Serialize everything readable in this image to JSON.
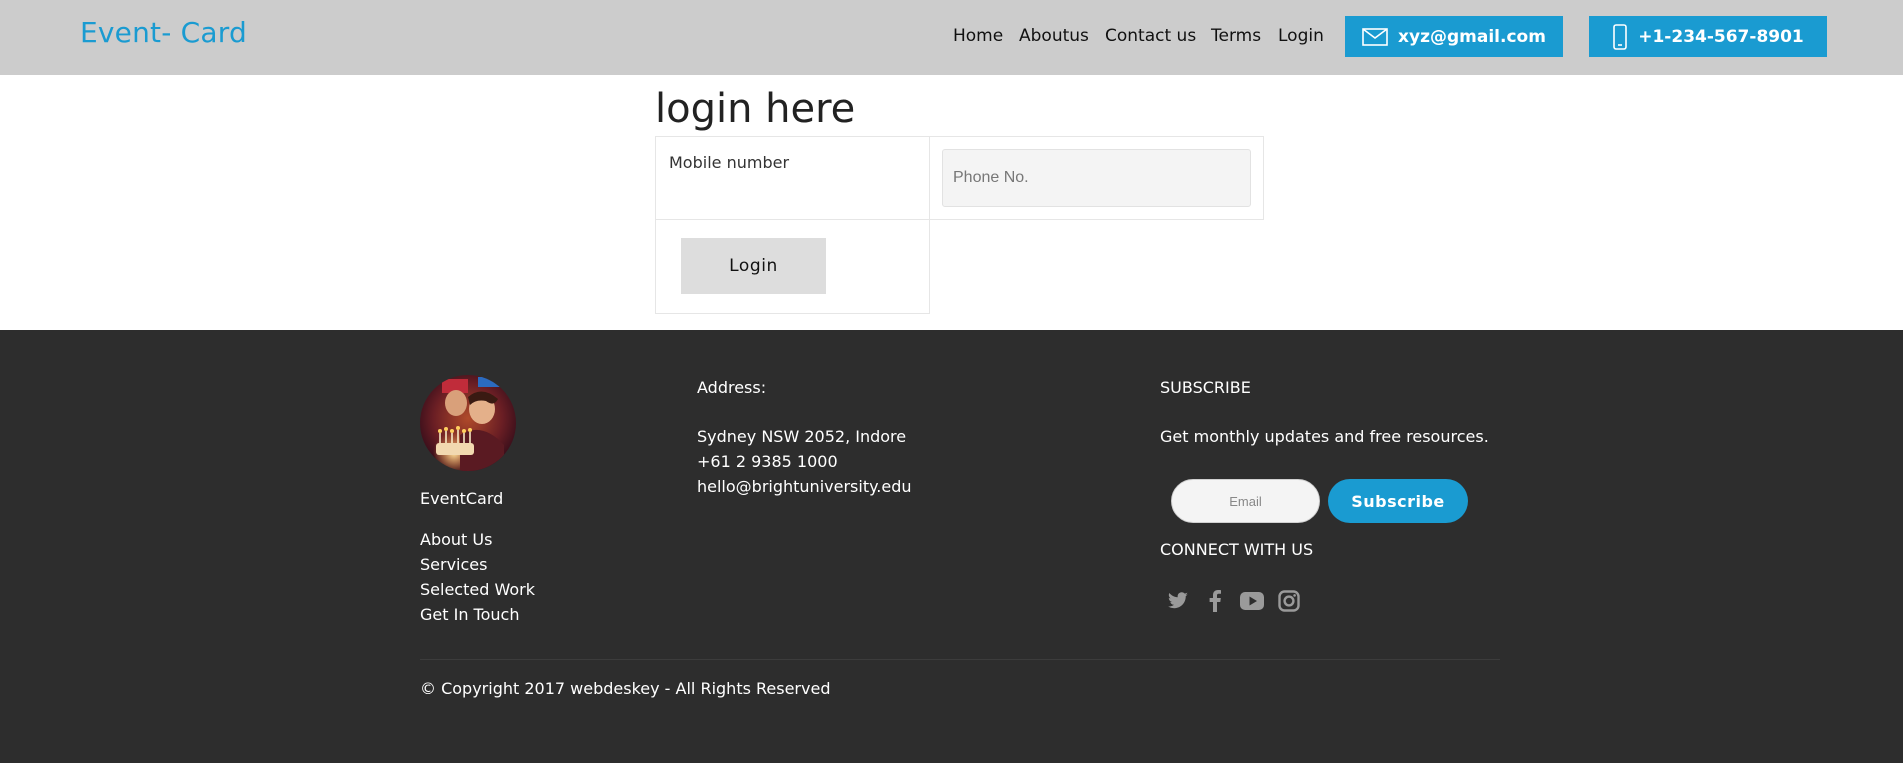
{
  "header": {
    "brand": "Event- Card",
    "nav": [
      "Home",
      "Aboutus",
      "Contact us",
      "Terms",
      "Login"
    ],
    "email": "xyz@gmail.com",
    "phone": "+1-234-567-8901",
    "icons": {
      "email": "envelope-icon",
      "phone": "mobile-phone-icon"
    },
    "accent_color": "#1a9bd1",
    "bar_color": "#cccccc"
  },
  "login": {
    "title": "login here",
    "mobile_label": "Mobile number",
    "phone_placeholder": "Phone No.",
    "button_label": "Login"
  },
  "footer": {
    "brand_name": "EventCard",
    "links": [
      "About Us",
      "Services",
      "Selected Work",
      "Get In Touch"
    ],
    "address_heading": "Address:",
    "address_lines": [
      "Sydney NSW 2052, Indore",
      "+61 2 9385 1000",
      "hello@brightuniversity.edu"
    ],
    "subscribe_heading": "SUBSCRIBE",
    "subscribe_text": "Get monthly updates and free resources.",
    "email_placeholder": "Email",
    "subscribe_button": "Subscribe",
    "connect_heading": "CONNECT WITH US",
    "social_icons": [
      "twitter-icon",
      "facebook-icon",
      "youtube-icon",
      "instagram-icon"
    ],
    "copyright": "© Copyright 2017 webdeskey - All Rights Reserved",
    "background_color": "#2d2d2d"
  }
}
